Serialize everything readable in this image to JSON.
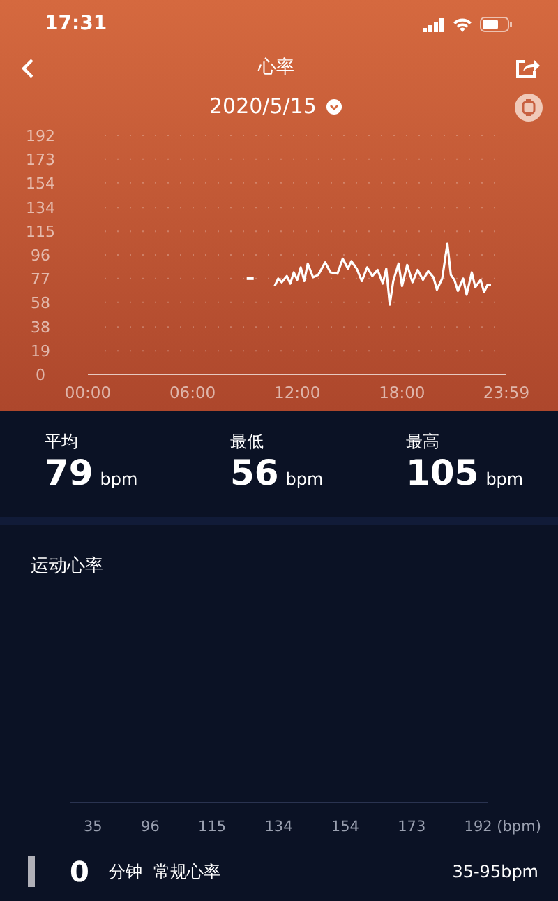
{
  "status_bar": {
    "time": "17:31"
  },
  "nav": {
    "title": "心率"
  },
  "date": "2020/5/15",
  "heart_chart": {
    "chart_data": {
      "type": "line",
      "x": [
        9.3,
        10.6,
        10.7,
        10.9,
        11.1,
        11.4,
        11.6,
        11.8,
        12.0,
        12.2,
        12.4,
        12.6,
        12.9,
        13.2,
        13.6,
        13.9,
        14.3,
        14.6,
        14.9,
        15.1,
        15.4,
        15.7,
        16.0,
        16.3,
        16.6,
        16.9,
        17.1,
        17.3,
        17.5,
        17.8,
        18.0,
        18.3,
        18.6,
        18.9,
        19.2,
        19.5,
        19.8,
        20.0,
        20.3,
        20.6,
        20.8,
        21.0,
        21.2,
        21.5,
        21.7,
        22.0,
        22.2,
        22.5,
        22.7,
        22.9,
        23.1
      ],
      "series": [
        {
          "color": "#ffffff",
          "values": [
            77,
            null,
            71,
            77,
            74,
            79,
            73,
            82,
            76,
            86,
            75,
            89,
            78,
            80,
            90,
            82,
            81,
            93,
            85,
            91,
            85,
            75,
            86,
            79,
            84,
            73,
            85,
            56,
            75,
            89,
            71,
            88,
            74,
            84,
            76,
            83,
            78,
            68,
            77,
            105,
            80,
            76,
            67,
            77,
            64,
            82,
            70,
            76,
            66,
            72,
            72
          ]
        }
      ],
      "xlim": [
        0,
        23.98
      ],
      "ylim": [
        0,
        192
      ],
      "grid": true,
      "xticks": [
        {
          "value": 0,
          "label": "00:00"
        },
        {
          "value": 6,
          "label": "06:00"
        },
        {
          "value": 12,
          "label": "12:00"
        },
        {
          "value": 18,
          "label": "18:00"
        },
        {
          "value": 23.98,
          "label": "23:59"
        }
      ],
      "yticks": [
        0,
        19,
        38,
        58,
        77,
        96,
        115,
        134,
        154,
        173,
        192
      ]
    }
  },
  "stats": [
    {
      "label": "平均",
      "value": "79",
      "unit": "bpm"
    },
    {
      "label": "最低",
      "value": "56",
      "unit": "bpm"
    },
    {
      "label": "最高",
      "value": "105",
      "unit": "bpm"
    }
  ],
  "exercise": {
    "title": "运动心率",
    "zone_axis": [
      "35",
      "96",
      "115",
      "134",
      "154",
      "173",
      "192 (bpm)"
    ],
    "row": {
      "value": "0",
      "unit": "分钟",
      "zone": "常规心率",
      "range": "35-95bpm"
    }
  }
}
